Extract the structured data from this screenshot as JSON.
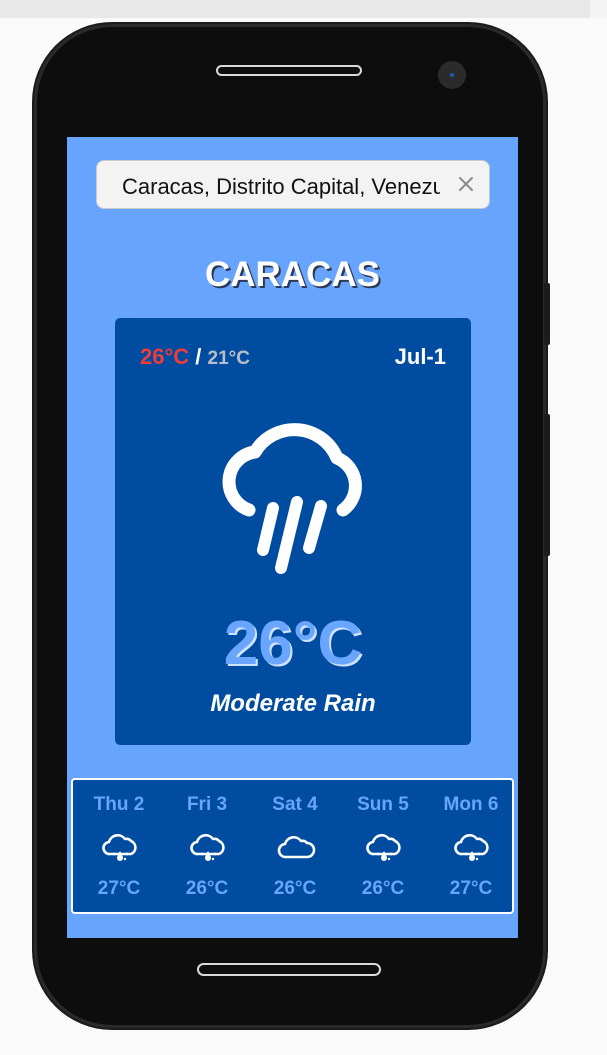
{
  "search": {
    "value": "Caracas, Distrito Capital, Venezuela",
    "clear_icon": "close-icon"
  },
  "city": "CARACAS",
  "today": {
    "high": "26°C",
    "separator": "/",
    "low": "21°C",
    "date": "Jul-1",
    "icon": "rain-cloud-icon",
    "temperature": "26°C",
    "condition": "Moderate Rain"
  },
  "forecast": [
    {
      "day": "Thu 2",
      "icon": "rain-drop-cloud-icon",
      "temp": "27°C"
    },
    {
      "day": "Fri 3",
      "icon": "rain-drop-cloud-icon",
      "temp": "26°C"
    },
    {
      "day": "Sat 4",
      "icon": "cloud-icon",
      "temp": "26°C"
    },
    {
      "day": "Sun 5",
      "icon": "rain-drop-cloud-icon",
      "temp": "26°C"
    },
    {
      "day": "Mon 6",
      "icon": "rain-drop-cloud-icon",
      "temp": "27°C"
    }
  ],
  "colors": {
    "screen_background": "#66a4fe",
    "card_background": "#004ca0",
    "high_temp": "#ee3b3b",
    "low_temp": "#b8bfc8"
  }
}
